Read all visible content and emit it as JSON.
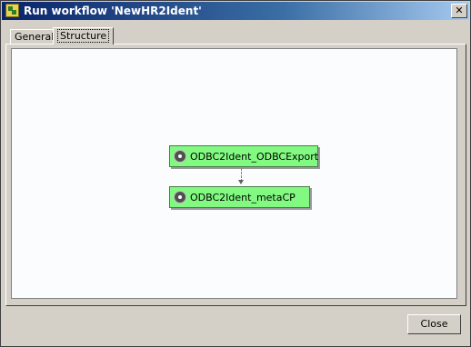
{
  "window": {
    "title": "Run workflow 'NewHR2Ident'",
    "close_glyph": "✕"
  },
  "tabs": [
    {
      "label": "General",
      "active": false
    },
    {
      "label": "Structure",
      "active": true
    }
  ],
  "workflow": {
    "nodes": [
      {
        "label": "ODBC2Ident_ODBCExport",
        "icon": "gear-icon"
      },
      {
        "label": "ODBC2Ident_metaCP",
        "icon": "gear-icon"
      }
    ],
    "connector": "dashed-arrow"
  },
  "buttons": {
    "close_label": "Close"
  },
  "colors": {
    "node_fill": "#82fa82",
    "canvas_bg": "#fafcfe",
    "dialog_bg": "#d4d0c8"
  }
}
